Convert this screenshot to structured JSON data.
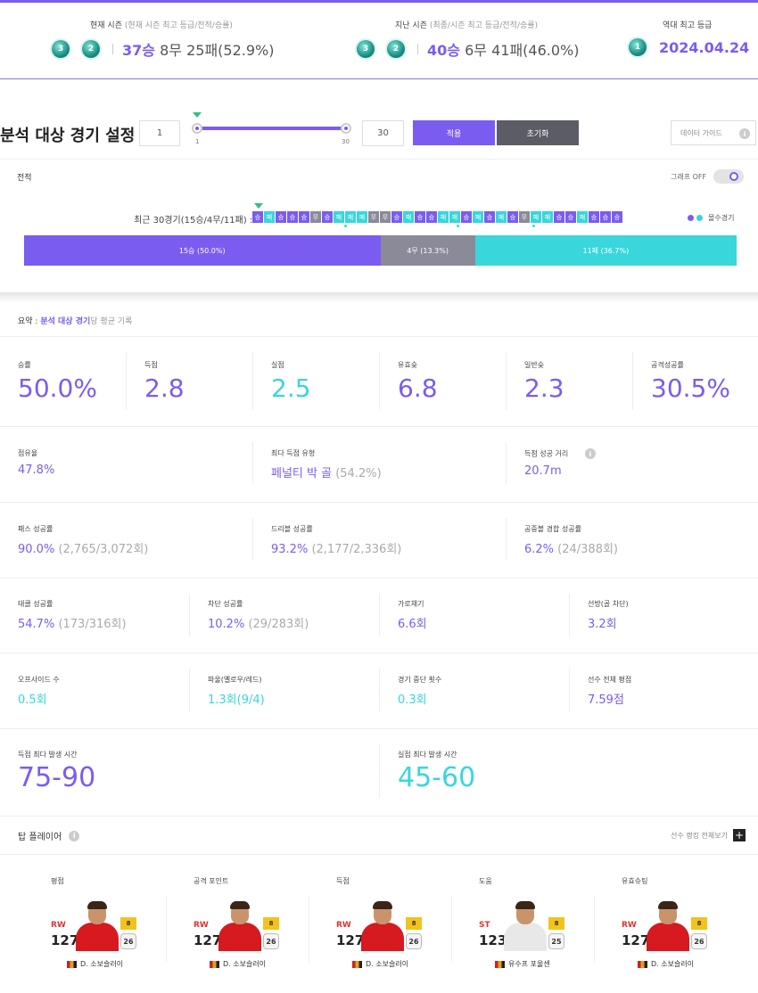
{
  "season_bar": {
    "current": {
      "title": "현재 시즌",
      "sub": "(현재 시즌 최고 등급/전적/승률)",
      "badge1": "3",
      "badge2": "2",
      "wins": "37승",
      "rest": "8무 25패(52.9%)"
    },
    "previous": {
      "title": "지난 시즌",
      "sub": "(최종/시즌 최고 등급/전적/승률)",
      "badge1": "3",
      "badge2": "2",
      "wins": "40승",
      "rest": "6무 41패(46.0%)"
    },
    "best": {
      "title": "역대 최고 등급",
      "badge1": "1",
      "date": "2024.04.24"
    }
  },
  "analysis": {
    "title": "분석 대상 경기 설정",
    "min_value": "1",
    "max_value": "30",
    "slider_min_label": "1",
    "slider_max_label": "30",
    "apply_label": "적용",
    "reset_label": "초기화",
    "guide_placeholder": "데이터 가이드"
  },
  "record": {
    "title": "전적",
    "graph_toggle_label": "그래프 OFF",
    "recent_label": "최근 30경기(15승/4무/11패) :",
    "games": [
      "승",
      "패",
      "승",
      "승",
      "승",
      "무",
      "승",
      "패",
      "패",
      "패",
      "무",
      "무",
      "승",
      "패",
      "승",
      "승",
      "패",
      "패",
      "승",
      "패",
      "승",
      "패",
      "승",
      "무",
      "패",
      "패",
      "승",
      "승",
      "패",
      "승",
      "승",
      "승"
    ],
    "legend_label": "몰수경기",
    "bar": {
      "win_label": "15승 (50.0%)",
      "draw_label": "4무 (13.3%)",
      "loss_label": "11패 (36.7%)",
      "win_pct": 50.0,
      "draw_pct": 13.3,
      "loss_pct": 36.7
    },
    "colors": {
      "win": "#7b5cf0",
      "draw": "#8a8a99",
      "loss": "#39d6dc"
    }
  },
  "summary": {
    "prefix": "요약 : ",
    "highlight": "분석 대상 경기",
    "suffix": "당 평균 기록",
    "row1": [
      {
        "label": "승률",
        "value": "50.0%",
        "color": "pur"
      },
      {
        "label": "득점",
        "value": "2.8",
        "color": "pur"
      },
      {
        "label": "실점",
        "value": "2.5",
        "color": "cy"
      },
      {
        "label": "유효슛",
        "value": "6.8",
        "color": "pur"
      },
      {
        "label": "일반슛",
        "value": "2.3",
        "color": "pur"
      },
      {
        "label": "공격성공률",
        "value": "30.5%",
        "color": "pur"
      }
    ],
    "row2": [
      {
        "label": "점유율",
        "value": "47.8%",
        "extra": ""
      },
      {
        "label": "최다 득점 유형",
        "value": "페널티 박 골",
        "extra": " (54.2%)"
      },
      {
        "label": "득점 성공 거리",
        "value": "20.7m",
        "extra": ""
      }
    ],
    "row3": [
      {
        "label": "패스 성공률",
        "value": "90.0%",
        "extra": " (2,765/3,072회)"
      },
      {
        "label": "드리블 성공률",
        "value": "93.2%",
        "extra": " (2,177/2,336회)"
      },
      {
        "label": "공중볼 경합 성공률",
        "value": "6.2%",
        "extra": " (24/388회)"
      }
    ],
    "row4": [
      {
        "label": "태클 성공률",
        "value": "54.7%",
        "extra": " (173/316회)",
        "color": "pur"
      },
      {
        "label": "차단 성공률",
        "value": "10.2%",
        "extra": " (29/283회)",
        "color": "pur"
      },
      {
        "label": "가로채기",
        "value": "6.6회",
        "extra": "",
        "color": "pur"
      },
      {
        "label": "선방(골 차단)",
        "value": "3.2회",
        "extra": "",
        "color": "pur"
      }
    ],
    "row5": [
      {
        "label": "오프사이드 수",
        "value": "0.5회",
        "color": "cy"
      },
      {
        "label": "파울(옐로우/레드)",
        "value": "1.3회(9/4)",
        "color": "cy"
      },
      {
        "label": "경기 중단 횟수",
        "value": "0.3회",
        "color": "cy"
      },
      {
        "label": "선수 전체 평점",
        "value": "7.59점",
        "color": "pur"
      }
    ],
    "row6": [
      {
        "label": "득점 최다 발생 시간",
        "value": "75-90",
        "color": "pur"
      },
      {
        "label": "실점 최다 발생 시간",
        "value": "45-60",
        "color": "cy"
      }
    ]
  },
  "top_players": {
    "title": "탑 플레이어",
    "ranking_link": "선수 랭킹 전체보기",
    "cards": [
      {
        "category": "평점",
        "position": "RW",
        "ovr": "127",
        "badge": "8",
        "level": "26",
        "name": "D. 소보슬러이",
        "jersey": "#d71920"
      },
      {
        "category": "공격 포인트",
        "position": "RW",
        "ovr": "127",
        "badge": "8",
        "level": "26",
        "name": "D. 소보슬러이",
        "jersey": "#d71920"
      },
      {
        "category": "득점",
        "position": "RW",
        "ovr": "127",
        "badge": "8",
        "level": "26",
        "name": "D. 소보슬러이",
        "jersey": "#d71920"
      },
      {
        "category": "도움",
        "position": "ST",
        "ovr": "123",
        "badge": "8",
        "level": "25",
        "name": "유수프 포울센",
        "jersey": "#e8e8e8"
      },
      {
        "category": "유효슈팅",
        "position": "RW",
        "ovr": "127",
        "badge": "8",
        "level": "26",
        "name": "D. 소보슬러이",
        "jersey": "#d71920"
      }
    ]
  }
}
